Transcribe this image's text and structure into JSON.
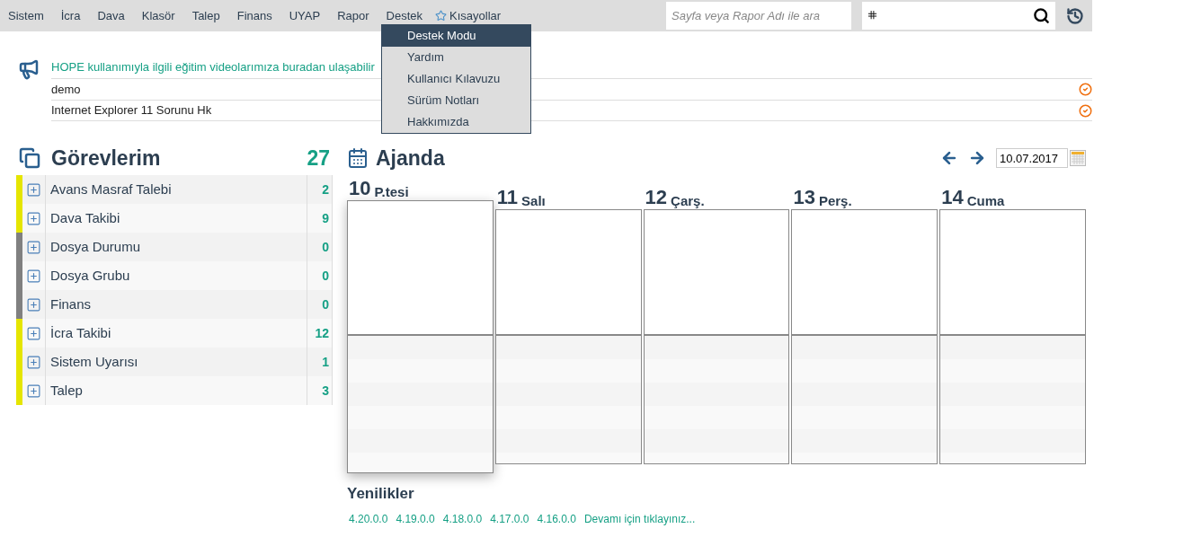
{
  "menu": [
    {
      "label": "Sistem",
      "kind": "plain"
    },
    {
      "label": "İcra",
      "kind": "plain"
    },
    {
      "label": "Dava",
      "kind": "plain"
    },
    {
      "label": "Klasör",
      "kind": "plain"
    },
    {
      "label": "Talep",
      "kind": "plain"
    },
    {
      "label": "Finans",
      "kind": "plain"
    },
    {
      "label": "UYAP",
      "kind": "plain"
    },
    {
      "label": "Rapor",
      "kind": "plain"
    },
    {
      "label": "Destek",
      "kind": "plain"
    },
    {
      "label": "Kısayollar",
      "kind": "star"
    }
  ],
  "dropdown": [
    {
      "label": "Destek Modu",
      "selected": true
    },
    {
      "label": "Yardım",
      "selected": false
    },
    {
      "label": "Kullanıcı Kılavuzu",
      "selected": false
    },
    {
      "label": "Sürüm Notları",
      "selected": false
    },
    {
      "label": "Hakkımızda",
      "selected": false
    }
  ],
  "search": {
    "placeholder": "Sayfa veya Rapor Adı ile ara"
  },
  "announcements": [
    {
      "text": "HOPE kullanımıyla ilgili eğitim videolarımıza buradan ulaşabilir",
      "kind": "link"
    },
    {
      "text": "demo",
      "kind": "item"
    },
    {
      "text": "Internet Explorer 11 Sorunu Hk",
      "kind": "item"
    }
  ],
  "tasks": {
    "title": "Görevlerim",
    "total": "27",
    "items": [
      {
        "label": "Avans Masraf Talebi",
        "count": "2",
        "color": "#e5e500"
      },
      {
        "label": "Dava Takibi",
        "count": "9",
        "color": "#e5e500"
      },
      {
        "label": "Dosya Durumu",
        "count": "0",
        "color": "#808080"
      },
      {
        "label": "Dosya Grubu",
        "count": "0",
        "color": "#808080"
      },
      {
        "label": "Finans",
        "count": "0",
        "color": "#808080"
      },
      {
        "label": "İcra Takibi",
        "count": "12",
        "color": "#e5e500"
      },
      {
        "label": "Sistem Uyarısı",
        "count": "1",
        "color": "#e5e500"
      },
      {
        "label": "Talep",
        "count": "3",
        "color": "#e5e500"
      }
    ]
  },
  "agenda": {
    "title": "Ajanda",
    "date": "10.07.2017",
    "days": [
      {
        "num": "10",
        "name": "P.tesi",
        "selected": true
      },
      {
        "num": "11",
        "name": "Salı",
        "selected": false
      },
      {
        "num": "12",
        "name": "Çarş.",
        "selected": false
      },
      {
        "num": "13",
        "name": "Perş.",
        "selected": false
      },
      {
        "num": "14",
        "name": "Cuma",
        "selected": false
      }
    ]
  },
  "news": {
    "title": "Yenilikler",
    "links": [
      "4.20.0.0",
      "4.19.0.0",
      "4.18.0.0",
      "4.17.0.0",
      "4.16.0.0",
      "Devamı için tıklayınız..."
    ]
  }
}
